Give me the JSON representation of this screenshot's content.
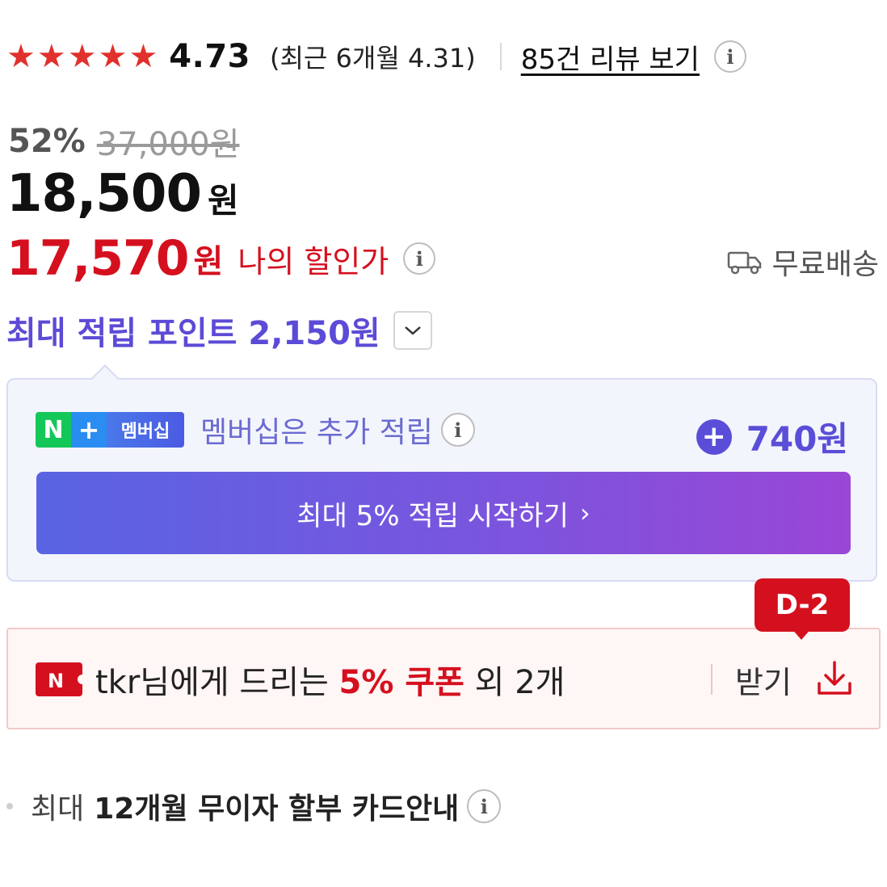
{
  "rating": {
    "stars_filled": 5,
    "value": "4.73",
    "recent": "(최근 6개월 4.31)",
    "review_link": "85건 리뷰 보기"
  },
  "price": {
    "discount_rate": "52%",
    "original": "37,000원",
    "sale_amount": "18,500",
    "sale_unit": "원",
    "my_price_amount": "17,570",
    "my_price_unit": "원",
    "my_price_label": "나의 할인가"
  },
  "shipping": {
    "label": "무료배송",
    "icon": "truck-icon"
  },
  "points": {
    "label": "최대 적립 포인트 2,150원"
  },
  "membership": {
    "badge_n": "N",
    "badge_plus": "+",
    "badge_text": "멤버십",
    "extra_label": "멤버십은 추가 적립",
    "plus_sign": "+",
    "extra_value": "740원",
    "cta_label": "최대 5% 적립 시작하기",
    "cta_chevron": "›"
  },
  "coupon": {
    "dday": "D-2",
    "text_pre": "tkr님에게 드리는 ",
    "text_strong": "5% 쿠폰",
    "text_post": " 외 2개",
    "receive_label": "받기"
  },
  "installment": {
    "prefix": "최대",
    "strong": "12개월 무이자 할부 카드안내"
  },
  "colors": {
    "sale_red": "#d5101e",
    "point_purple": "#5b4bd6",
    "naver_green": "#14c759",
    "star_red": "#e0312d"
  }
}
